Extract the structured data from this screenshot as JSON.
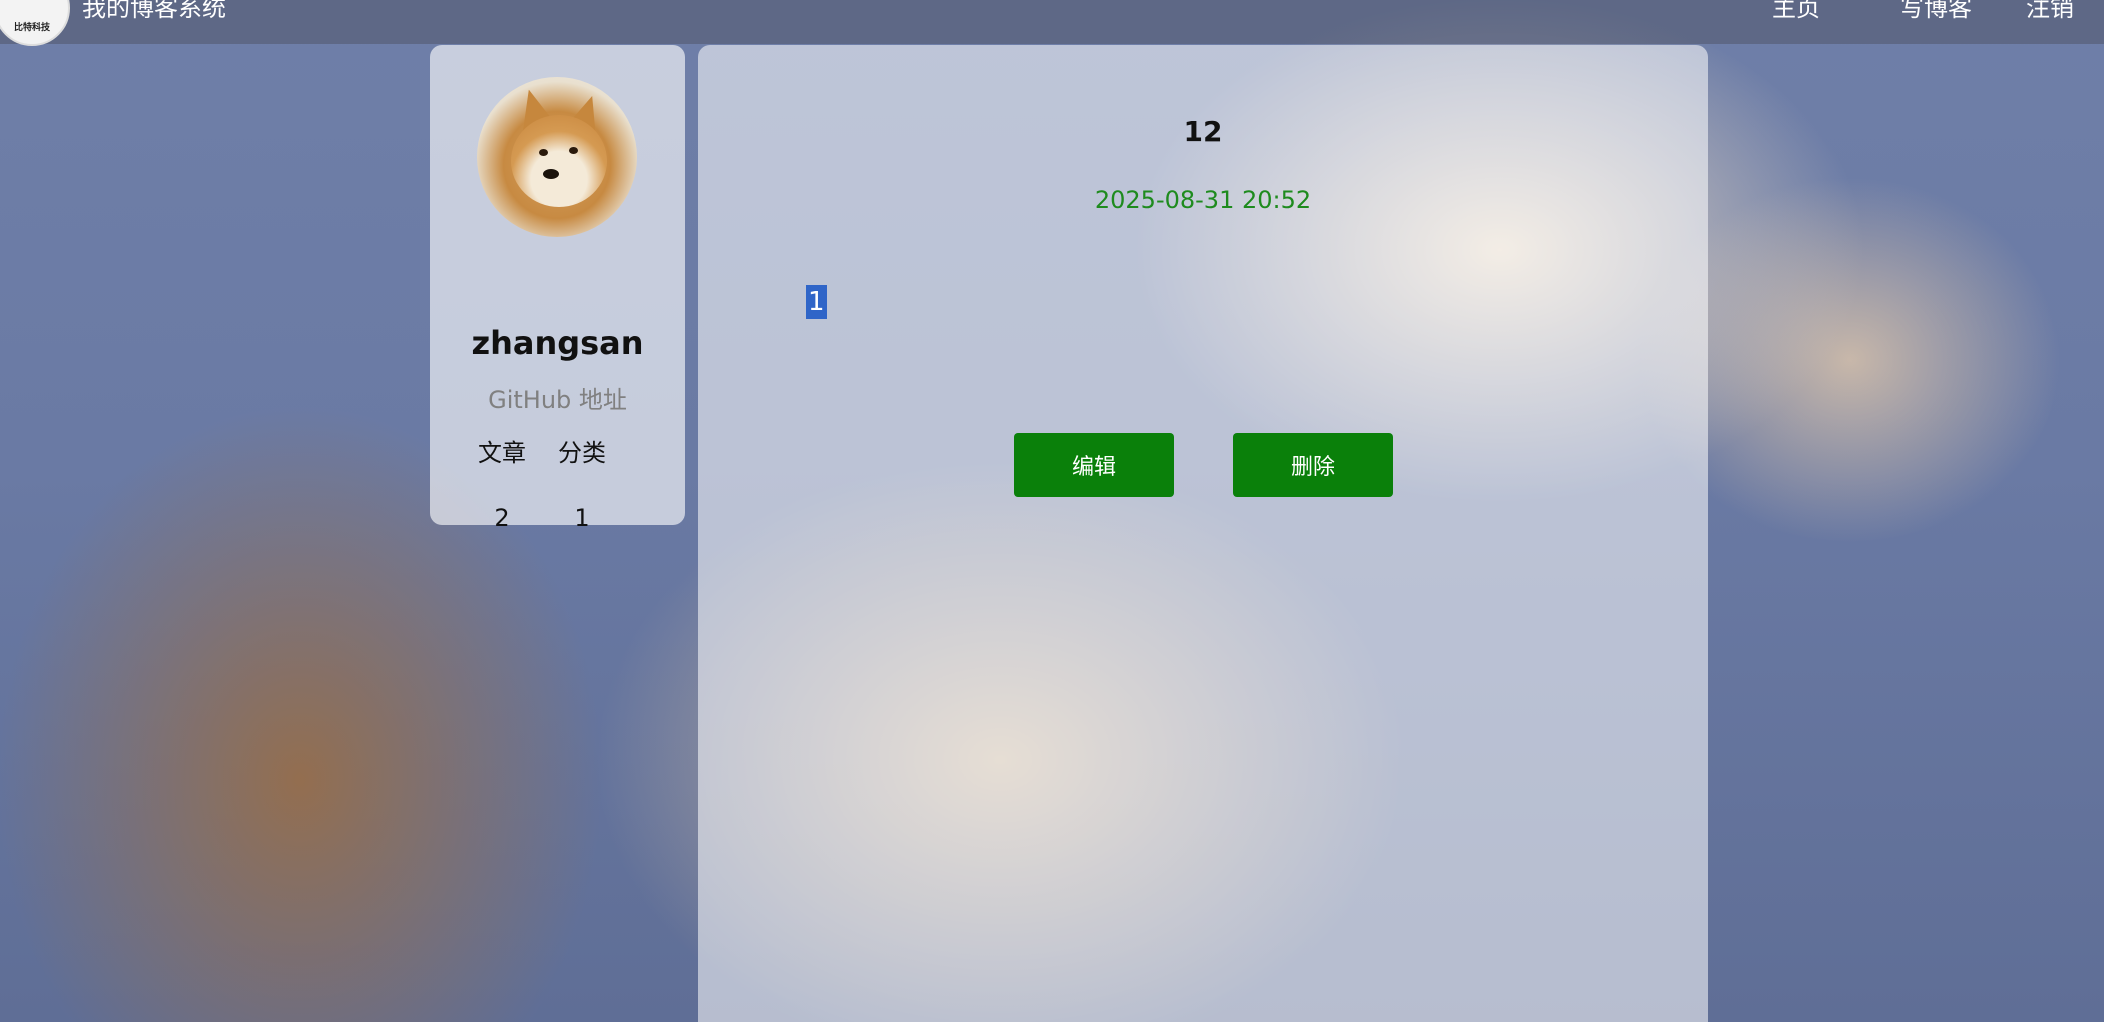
{
  "header": {
    "site_title": "我的博客系统",
    "nav": {
      "home": "主页",
      "write": "写博客",
      "logout": "注销"
    }
  },
  "profile": {
    "username": "zhangsan",
    "github_link": "GitHub 地址",
    "stats": {
      "articles_label": "文章",
      "categories_label": "分类",
      "articles_count": "2",
      "categories_count": "1"
    }
  },
  "blog": {
    "title": "12",
    "date": "2025-08-31 20:52",
    "content": "1",
    "edit_label": "编辑",
    "delete_label": "删除"
  },
  "colors": {
    "button_green": "#0a800a",
    "date_green": "#1e8b1e",
    "selection_blue": "#2f65c8"
  }
}
